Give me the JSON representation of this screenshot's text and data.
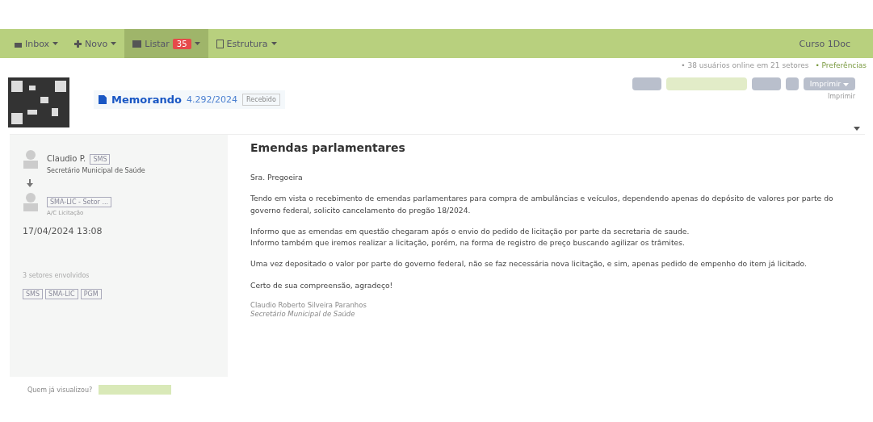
{
  "navbar": {
    "items": [
      {
        "label": "Inbox",
        "selected": false
      },
      {
        "label": "Novo",
        "selected": false
      },
      {
        "label": "Listar",
        "selected": true,
        "badge": "35"
      },
      {
        "label": "Estrutura",
        "selected": false
      }
    ],
    "user": "Curso 1Doc"
  },
  "online": {
    "text": "• 38 usuários online em 21 setores",
    "link": "• Preferências"
  },
  "document": {
    "type": "Memorando",
    "number": "4.292/2024",
    "status": "Recebido",
    "print_button": "Imprimir",
    "print_label": "Imprimir"
  },
  "sender": {
    "name": "Claudio P.",
    "tag": "SMS",
    "role": "Secretário Municipal de Saúde"
  },
  "recipient": {
    "tag": "SMA-LIC - Setor ...",
    "note": "A/C Licitação"
  },
  "date": "17/04/2024 13:08",
  "involved": {
    "label": "3 setores envolvidos",
    "tags": [
      "SMS",
      "SMA-LIC",
      "PGM"
    ]
  },
  "message": {
    "title": "Emendas parlamentares",
    "paragraphs": [
      "Sra. Pregoeira",
      "Tendo em vista o recebimento de emendas parlamentares para compra de ambulâncias e veículos, dependendo apenas do depósito de valores por parte do governo federal, solicito cancelamento do pregão 18/2024.",
      "Informo que as emendas em questão chegaram após o envio do pedido de licitação por parte da secretaria de saude.\nInformo também que iremos realizar a licitação, porém, na forma de registro de preço buscando agilizar os trâmites.",
      "Uma vez depositado o valor por parte do governo federal, não se faz necessária nova licitação, e sim, apenas pedido de empenho do item já licitado.",
      "Certo de sua compreensão, agradeço!"
    ],
    "signature_name": "Claudio Roberto Silveira Paranhos",
    "signature_role": "Secretário Municipal de Saúde"
  },
  "viewed_label": "Quem já visualizou?"
}
